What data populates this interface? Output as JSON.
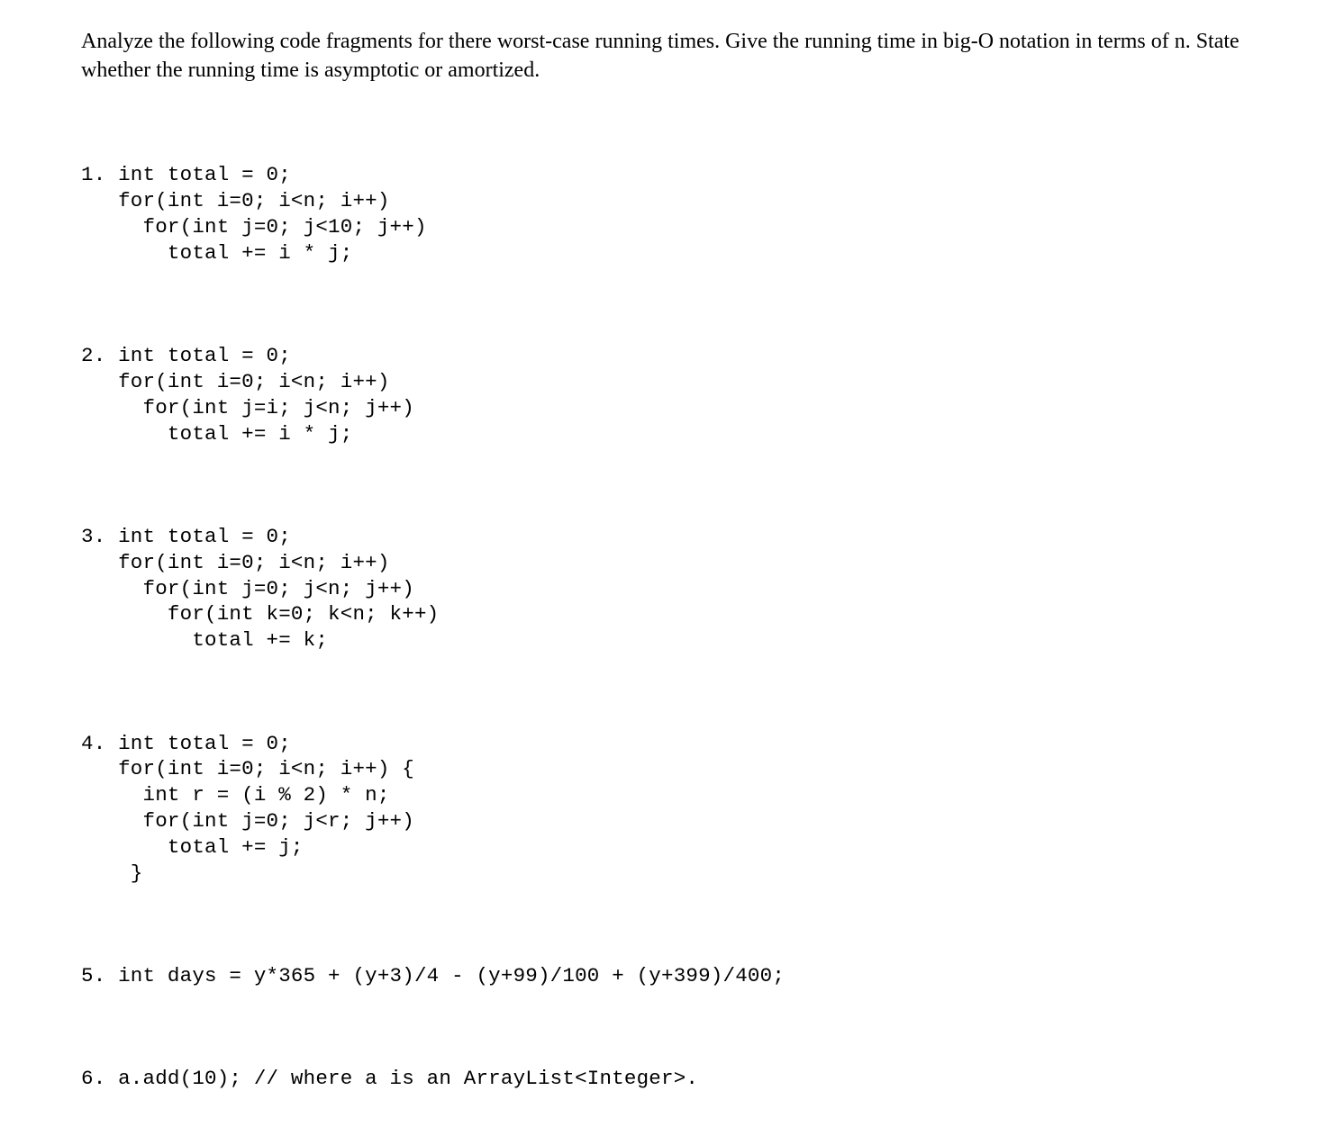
{
  "intro": "Analyze the following code fragments for there worst-case running times. Give the running time in big-O notation in terms of n. State whether the running time is asymptotic or amortized.",
  "blocks": [
    {
      "lines": [
        "1. int total = 0;",
        "   for(int i=0; i<n; i++)",
        "     for(int j=0; j<10; j++)",
        "       total += i * j;"
      ]
    },
    {
      "lines": [
        "2. int total = 0;",
        "   for(int i=0; i<n; i++)",
        "     for(int j=i; j<n; j++)",
        "       total += i * j;"
      ]
    },
    {
      "lines": [
        "3. int total = 0;",
        "   for(int i=0; i<n; i++)",
        "     for(int j=0; j<n; j++)",
        "       for(int k=0; k<n; k++)",
        "         total += k;"
      ]
    },
    {
      "lines": [
        "4. int total = 0;",
        "   for(int i=0; i<n; i++) {",
        "     int r = (i % 2) * n;",
        "     for(int j=0; j<r; j++)",
        "       total += j;",
        "    }"
      ]
    },
    {
      "lines": [
        "5. int days = y*365 + (y+3)/4 - (y+99)/100 + (y+399)/400;"
      ]
    },
    {
      "lines": [
        "6. a.add(10); // where a is an ArrayList<Integer>."
      ]
    }
  ]
}
